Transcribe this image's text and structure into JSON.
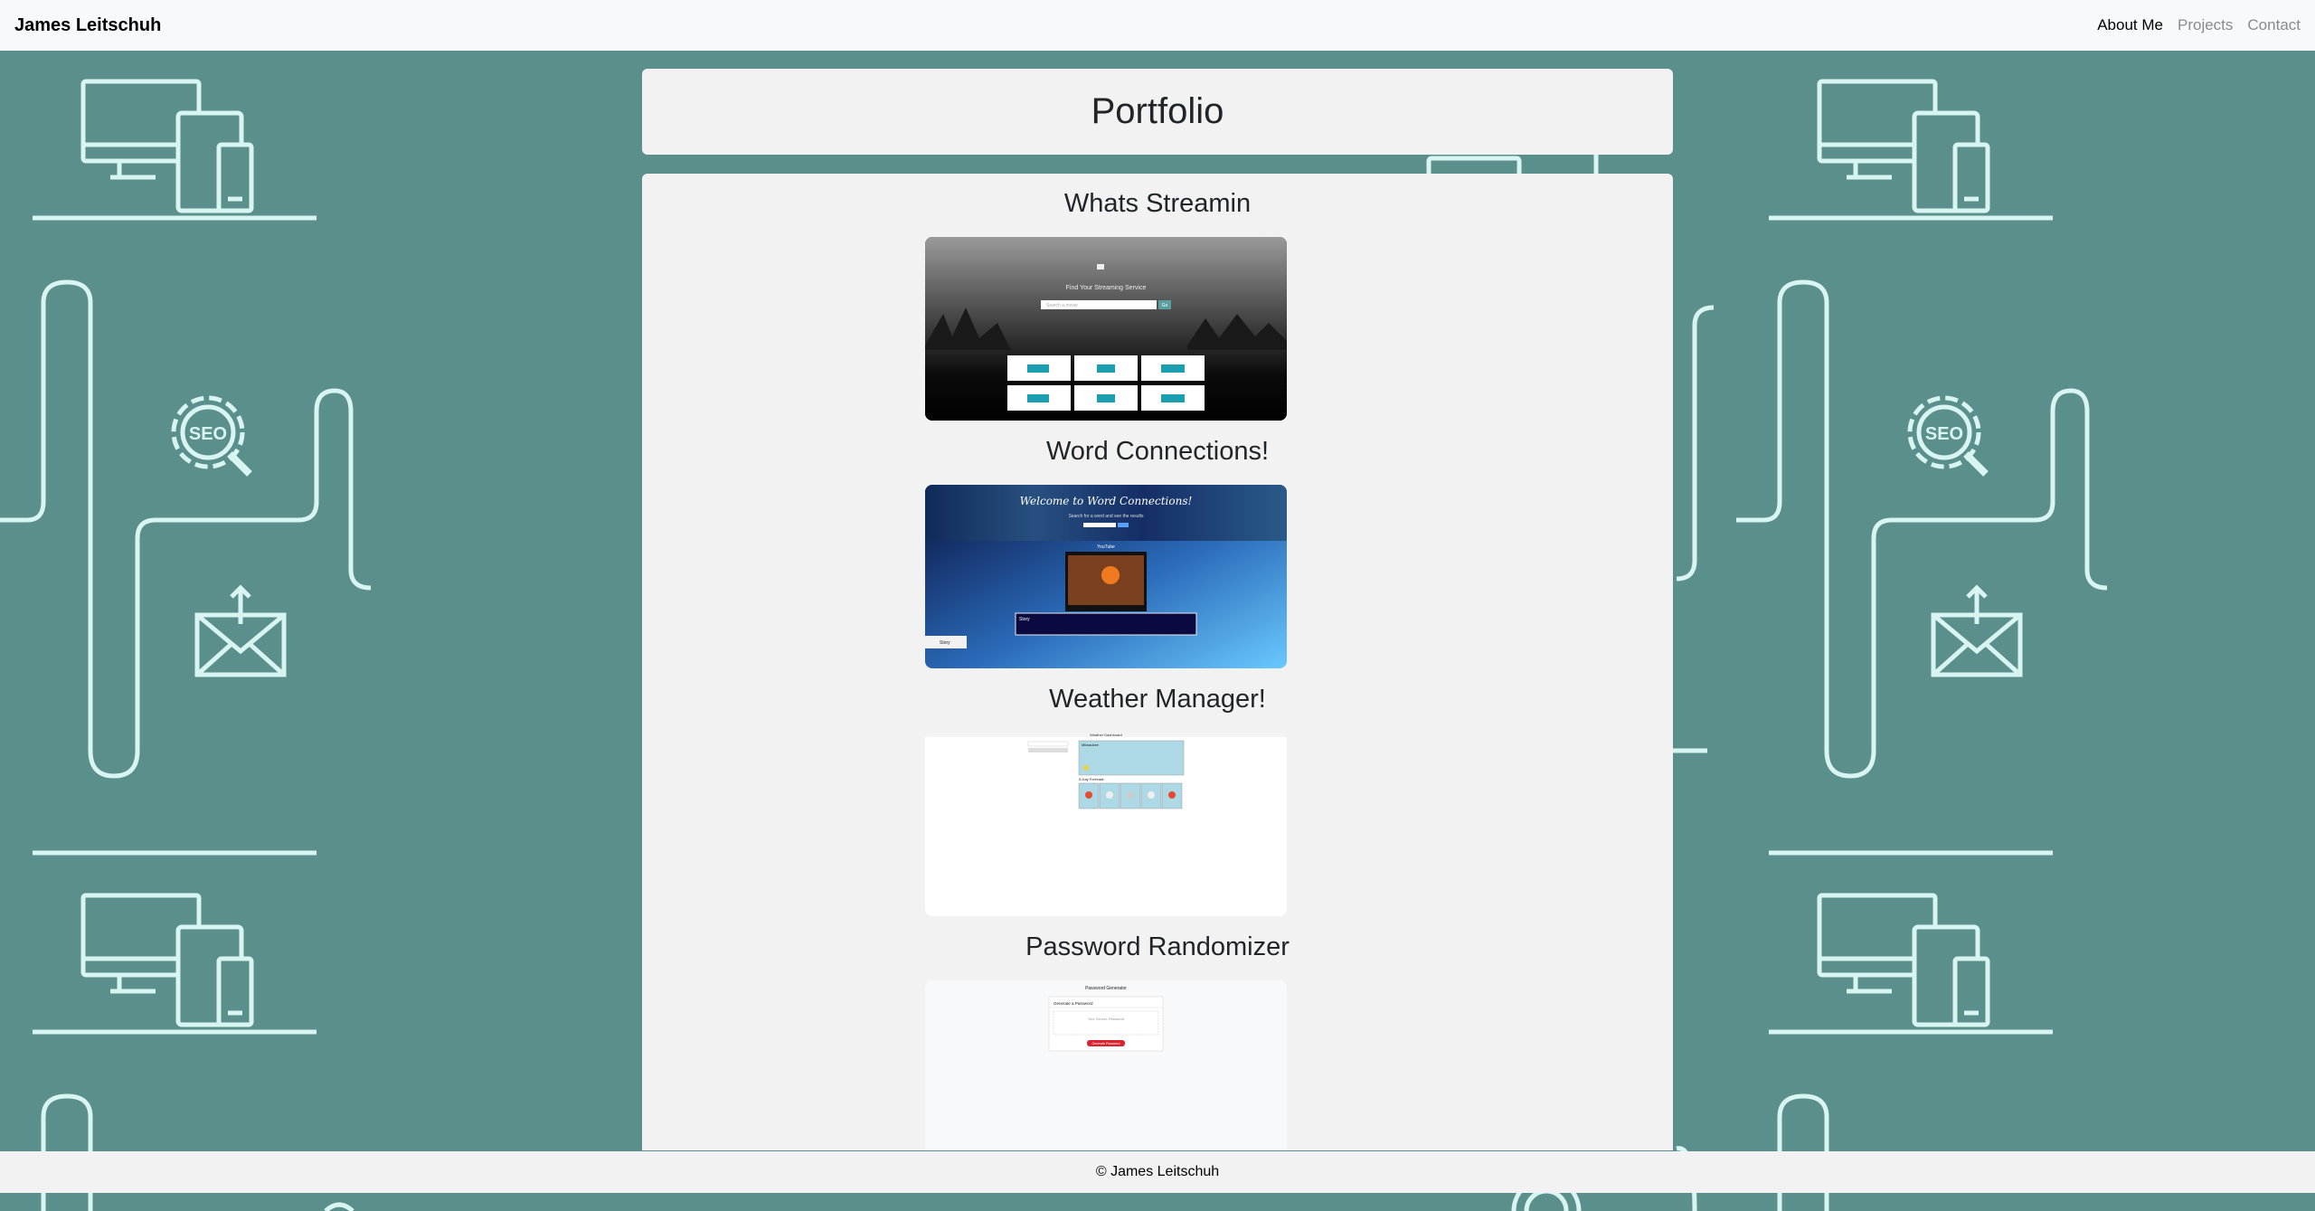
{
  "navbar": {
    "brand": "James Leitschuh",
    "links": [
      "About Me",
      "Projects",
      "Contact"
    ]
  },
  "header": {
    "title": "Portfolio"
  },
  "projects": [
    {
      "title": "Whats Streamin",
      "screenshot": {
        "heading": "Find Your Streaming Service",
        "search_placeholder": "Search a movie",
        "search_button": "Go"
      }
    },
    {
      "title": "Word Connections!",
      "screenshot": {
        "heading": "Welcome to Word Connections!",
        "subheading": "Search for a word and see the results",
        "video_label": "YouTube",
        "info_label": "Story",
        "button_label": "Story"
      }
    },
    {
      "title": "Weather Manager!",
      "screenshot": {
        "heading": "Weather Dashboard",
        "current_label": "Milwaukee",
        "forecast_label": "5-Day Forecast:"
      }
    },
    {
      "title": "Password Randomizer",
      "screenshot": {
        "heading": "Password Generator",
        "card_title": "Generate a Password",
        "placeholder": "Your Secure Password",
        "button_label": "Generate Password"
      }
    }
  ],
  "footer": {
    "text": "© James Leitschuh"
  },
  "colors": {
    "background": "#5a8f8b",
    "pattern_line": "#d8f5f1",
    "card": "#f2f2f2",
    "navbar": "#f8f9fa"
  },
  "icons": [
    "devices-icon",
    "seo-gear-icon",
    "mail-icon",
    "browser-window-icon"
  ]
}
